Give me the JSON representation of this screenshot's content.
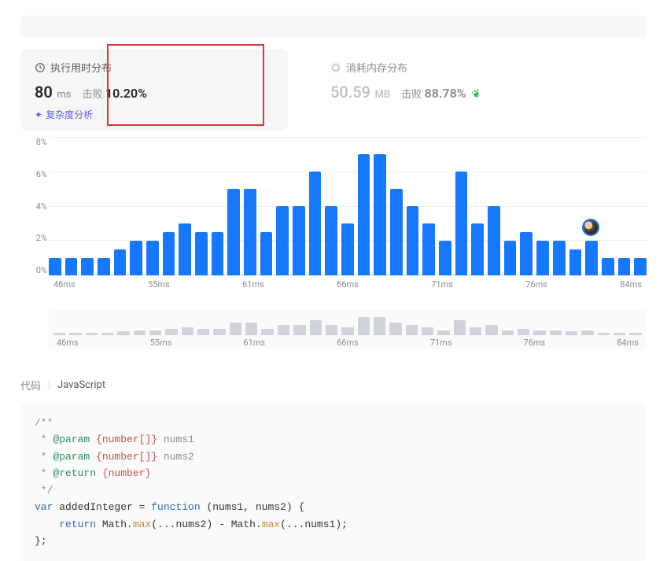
{
  "perf": {
    "runtime": {
      "title": "执行用时分布",
      "value": "80",
      "unit": "ms",
      "beat_label": "击败",
      "beat_value": "10.20%",
      "analysis_label": "复杂度分析"
    },
    "memory": {
      "title": "消耗内存分布",
      "value": "50.59",
      "unit": "MB",
      "beat_label": "击败",
      "beat_value": "88.78%"
    }
  },
  "chart_data": {
    "type": "bar",
    "ylabel": "%",
    "ylim": [
      0,
      8
    ],
    "yticks": [
      "8%",
      "6%",
      "4%",
      "2%",
      "0%"
    ],
    "xticks": [
      "46ms",
      "55ms",
      "61ms",
      "66ms",
      "71ms",
      "76ms",
      "84ms"
    ],
    "values": [
      1.0,
      1.0,
      1.0,
      1.0,
      1.5,
      2.0,
      2.0,
      2.5,
      3.0,
      2.5,
      2.5,
      5.0,
      5.0,
      2.5,
      4.0,
      4.0,
      6.0,
      4.0,
      3.0,
      7.0,
      7.0,
      5.0,
      4.0,
      3.0,
      2.0,
      6.0,
      3.0,
      4.0,
      2.0,
      2.5,
      2.0,
      2.0,
      1.5,
      2.0,
      1.0,
      1.0,
      1.0
    ],
    "marker_index": 33
  },
  "mini_chart": {
    "xticks": [
      "46ms",
      "55ms",
      "61ms",
      "66ms",
      "71ms",
      "76ms",
      "84ms"
    ],
    "values": [
      1.0,
      1.0,
      1.0,
      1.0,
      1.5,
      2.0,
      2.0,
      2.5,
      3.0,
      2.5,
      2.5,
      5.0,
      5.0,
      2.5,
      4.0,
      4.0,
      6.0,
      4.0,
      3.0,
      7.0,
      7.0,
      5.0,
      4.0,
      3.0,
      2.0,
      6.0,
      3.0,
      4.0,
      2.0,
      2.5,
      2.0,
      2.0,
      1.5,
      2.0,
      1.0,
      1.0,
      1.0
    ]
  },
  "code": {
    "section_label": "代码",
    "language": "JavaScript",
    "lines": {
      "c1": "/**",
      "c2_star": " * ",
      "c2_tag": "@param",
      "c2_type": "{number[]}",
      "c2_name": " nums1",
      "c3_star": " * ",
      "c3_tag": "@param",
      "c3_type": "{number[]}",
      "c3_name": " nums2",
      "c4_star": " * ",
      "c4_tag": "@return",
      "c4_type": "{number}",
      "c5": " */",
      "l1_var": "var",
      "l1_name": " addedInteger ",
      "l1_eq": "=",
      "l1_func": " function",
      "l1_rest": " (nums1, nums2) {",
      "l2_indent": "    ",
      "l2_ret": "return",
      "l2_call1a": " Math.",
      "l2_call1b": "max",
      "l2_args1": "(...nums2) ",
      "l2_minus": "-",
      "l2_call2a": " Math.",
      "l2_call2b": "max",
      "l2_args2": "(...nums1);",
      "l3": "};"
    }
  }
}
